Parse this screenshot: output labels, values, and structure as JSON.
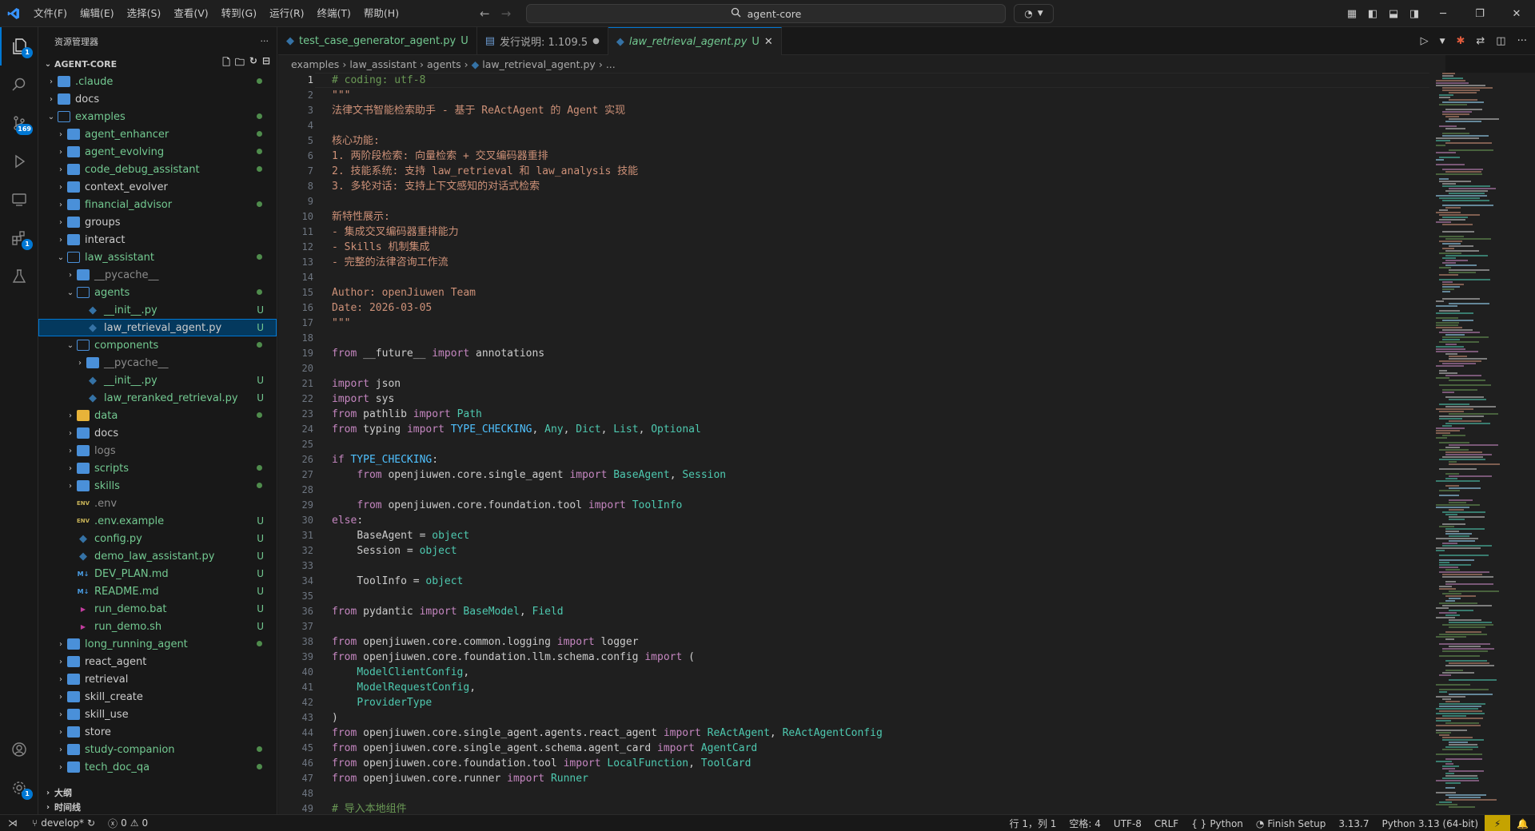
{
  "menu": [
    "文件(F)",
    "编辑(E)",
    "选择(S)",
    "查看(V)",
    "转到(G)",
    "运行(R)",
    "终端(T)",
    "帮助(H)"
  ],
  "command_center": {
    "text": "agent-core"
  },
  "activity": {
    "scm_badge": "169",
    "explorer_badge": "1",
    "ext_badge": "1",
    "account_badge": "1"
  },
  "sidebar": {
    "title": "资源管理器",
    "root": "AGENT-CORE",
    "tree": [
      {
        "label": ".claude",
        "depth": 0,
        "kind": "folder",
        "open": false,
        "color": "green",
        "status": "dot"
      },
      {
        "label": "docs",
        "depth": 0,
        "kind": "folder",
        "open": false,
        "color": "white",
        "status": ""
      },
      {
        "label": "examples",
        "depth": 0,
        "kind": "folder",
        "open": true,
        "color": "green",
        "status": "dot"
      },
      {
        "label": "agent_enhancer",
        "depth": 1,
        "kind": "folder",
        "open": false,
        "color": "green",
        "status": "dot"
      },
      {
        "label": "agent_evolving",
        "depth": 1,
        "kind": "folder",
        "open": false,
        "color": "green",
        "status": "dot"
      },
      {
        "label": "code_debug_assistant",
        "depth": 1,
        "kind": "folder",
        "open": false,
        "color": "green",
        "status": "dot"
      },
      {
        "label": "context_evolver",
        "depth": 1,
        "kind": "folder",
        "open": false,
        "color": "white",
        "status": ""
      },
      {
        "label": "financial_advisor",
        "depth": 1,
        "kind": "folder",
        "open": false,
        "color": "green",
        "status": "dot"
      },
      {
        "label": "groups",
        "depth": 1,
        "kind": "folder",
        "open": false,
        "color": "white",
        "status": ""
      },
      {
        "label": "interact",
        "depth": 1,
        "kind": "folder",
        "open": false,
        "color": "white",
        "status": ""
      },
      {
        "label": "law_assistant",
        "depth": 1,
        "kind": "folder",
        "open": true,
        "color": "green",
        "status": "dot"
      },
      {
        "label": "__pycache__",
        "depth": 2,
        "kind": "folder",
        "open": false,
        "color": "gray",
        "status": ""
      },
      {
        "label": "agents",
        "depth": 2,
        "kind": "folder",
        "open": true,
        "color": "green",
        "status": "dot"
      },
      {
        "label": "__init__.py",
        "depth": 3,
        "kind": "py",
        "color": "green",
        "status": "U"
      },
      {
        "label": "law_retrieval_agent.py",
        "depth": 3,
        "kind": "py",
        "color": "white",
        "status": "U",
        "selected": true
      },
      {
        "label": "components",
        "depth": 2,
        "kind": "folder",
        "open": true,
        "color": "green",
        "status": "dot"
      },
      {
        "label": "__pycache__",
        "depth": 3,
        "kind": "folder",
        "open": false,
        "color": "gray",
        "status": ""
      },
      {
        "label": "__init__.py",
        "depth": 3,
        "kind": "py",
        "color": "green",
        "status": "U"
      },
      {
        "label": "law_reranked_retrieval.py",
        "depth": 3,
        "kind": "py",
        "color": "green",
        "status": "U"
      },
      {
        "label": "data",
        "depth": 2,
        "kind": "folder-yellow",
        "open": false,
        "color": "green",
        "status": "dot"
      },
      {
        "label": "docs",
        "depth": 2,
        "kind": "folder",
        "open": false,
        "color": "white",
        "status": ""
      },
      {
        "label": "logs",
        "depth": 2,
        "kind": "folder",
        "open": false,
        "color": "gray",
        "status": ""
      },
      {
        "label": "scripts",
        "depth": 2,
        "kind": "folder",
        "open": false,
        "color": "green",
        "status": "dot"
      },
      {
        "label": "skills",
        "depth": 2,
        "kind": "folder",
        "open": false,
        "color": "green",
        "status": "dot"
      },
      {
        "label": ".env",
        "depth": 2,
        "kind": "env",
        "color": "gray",
        "status": ""
      },
      {
        "label": ".env.example",
        "depth": 2,
        "kind": "env",
        "color": "green",
        "status": "U"
      },
      {
        "label": "config.py",
        "depth": 2,
        "kind": "py",
        "color": "green",
        "status": "U"
      },
      {
        "label": "demo_law_assistant.py",
        "depth": 2,
        "kind": "py",
        "color": "green",
        "status": "U"
      },
      {
        "label": "DEV_PLAN.md",
        "depth": 2,
        "kind": "md",
        "color": "green",
        "status": "U"
      },
      {
        "label": "README.md",
        "depth": 2,
        "kind": "md",
        "color": "green",
        "status": "U"
      },
      {
        "label": "run_demo.bat",
        "depth": 2,
        "kind": "bat",
        "color": "green",
        "status": "U"
      },
      {
        "label": "run_demo.sh",
        "depth": 2,
        "kind": "bat",
        "color": "green",
        "status": "U"
      },
      {
        "label": "long_running_agent",
        "depth": 1,
        "kind": "folder",
        "open": false,
        "color": "green",
        "status": "dot"
      },
      {
        "label": "react_agent",
        "depth": 1,
        "kind": "folder",
        "open": false,
        "color": "white",
        "status": ""
      },
      {
        "label": "retrieval",
        "depth": 1,
        "kind": "folder",
        "open": false,
        "color": "white",
        "status": ""
      },
      {
        "label": "skill_create",
        "depth": 1,
        "kind": "folder",
        "open": false,
        "color": "white",
        "status": ""
      },
      {
        "label": "skill_use",
        "depth": 1,
        "kind": "folder",
        "open": false,
        "color": "white",
        "status": ""
      },
      {
        "label": "store",
        "depth": 1,
        "kind": "folder",
        "open": false,
        "color": "white",
        "status": ""
      },
      {
        "label": "study-companion",
        "depth": 1,
        "kind": "folder",
        "open": false,
        "color": "green",
        "status": "dot"
      },
      {
        "label": "tech_doc_qa",
        "depth": 1,
        "kind": "folder",
        "open": false,
        "color": "green",
        "status": "dot"
      }
    ],
    "outline": "大纲",
    "timeline": "时间线"
  },
  "tabs": [
    {
      "label": "test_case_generator_agent.py",
      "suffix": "U",
      "icon": "python-icon",
      "active": false
    },
    {
      "label": "发行说明: 1.109.5",
      "suffix": "",
      "icon": "document-icon",
      "active": false
    },
    {
      "label": "law_retrieval_agent.py",
      "suffix": "U",
      "icon": "python-icon",
      "active": true
    }
  ],
  "breadcrumb": [
    "examples",
    "law_assistant",
    "agents",
    "law_retrieval_agent.py",
    "..."
  ],
  "code_lines": [
    [
      [
        "cm",
        "# coding: utf-8"
      ]
    ],
    [
      [
        "doc",
        "\"\"\""
      ]
    ],
    [
      [
        "doc",
        "法律文书智能检索助手 - 基于 ReActAgent 的 Agent 实现"
      ]
    ],
    [
      [
        "doc",
        ""
      ]
    ],
    [
      [
        "doc",
        "核心功能:"
      ]
    ],
    [
      [
        "doc",
        "1. 两阶段检索: 向量检索 + 交叉编码器重排"
      ]
    ],
    [
      [
        "doc",
        "2. 技能系统: 支持 law_retrieval 和 law_analysis 技能"
      ]
    ],
    [
      [
        "doc",
        "3. 多轮对话: 支持上下文感知的对话式检索"
      ]
    ],
    [
      [
        "doc",
        ""
      ]
    ],
    [
      [
        "doc",
        "新特性展示:"
      ]
    ],
    [
      [
        "doc",
        "- 集成交叉编码器重排能力"
      ]
    ],
    [
      [
        "doc",
        "- Skills 机制集成"
      ]
    ],
    [
      [
        "doc",
        "- 完整的法律咨询工作流"
      ]
    ],
    [
      [
        "doc",
        ""
      ]
    ],
    [
      [
        "doc",
        "Author: openJiuwen Team"
      ]
    ],
    [
      [
        "doc",
        "Date: 2026-03-05"
      ]
    ],
    [
      [
        "doc",
        "\"\"\""
      ]
    ],
    [],
    [
      [
        "kw",
        "from"
      ],
      [
        "tx",
        " __future__ "
      ],
      [
        "kw",
        "import"
      ],
      [
        "tx",
        " annotations"
      ]
    ],
    [],
    [
      [
        "kw",
        "import"
      ],
      [
        "tx",
        " json"
      ]
    ],
    [
      [
        "kw",
        "import"
      ],
      [
        "tx",
        " sys"
      ]
    ],
    [
      [
        "kw",
        "from"
      ],
      [
        "tx",
        " pathlib "
      ],
      [
        "kw",
        "import"
      ],
      [
        "tx",
        " "
      ],
      [
        "cls",
        "Path"
      ]
    ],
    [
      [
        "kw",
        "from"
      ],
      [
        "tx",
        " typing "
      ],
      [
        "kw",
        "import"
      ],
      [
        "tx",
        " "
      ],
      [
        "cn",
        "TYPE_CHECKING"
      ],
      [
        "tx",
        ", "
      ],
      [
        "cls",
        "Any"
      ],
      [
        "tx",
        ", "
      ],
      [
        "cls",
        "Dict"
      ],
      [
        "tx",
        ", "
      ],
      [
        "cls",
        "List"
      ],
      [
        "tx",
        ", "
      ],
      [
        "cls",
        "Optional"
      ]
    ],
    [],
    [
      [
        "kw",
        "if"
      ],
      [
        "tx",
        " "
      ],
      [
        "cn",
        "TYPE_CHECKING"
      ],
      [
        "tx",
        ":"
      ]
    ],
    [
      [
        "tx",
        "    "
      ],
      [
        "kw",
        "from"
      ],
      [
        "tx",
        " openjiuwen.core.single_agent "
      ],
      [
        "kw",
        "import"
      ],
      [
        "tx",
        " "
      ],
      [
        "cls",
        "BaseAgent"
      ],
      [
        "tx",
        ", "
      ],
      [
        "cls",
        "Session"
      ]
    ],
    [],
    [
      [
        "tx",
        "    "
      ],
      [
        "kw",
        "from"
      ],
      [
        "tx",
        " openjiuwen.core.foundation.tool "
      ],
      [
        "kw",
        "import"
      ],
      [
        "tx",
        " "
      ],
      [
        "cls",
        "ToolInfo"
      ]
    ],
    [
      [
        "kw",
        "else"
      ],
      [
        "tx",
        ":"
      ]
    ],
    [
      [
        "tx",
        "    "
      ],
      [
        "tx",
        "BaseAgent"
      ],
      [
        "tx",
        " = "
      ],
      [
        "bi",
        "object"
      ]
    ],
    [
      [
        "tx",
        "    "
      ],
      [
        "tx",
        "Session"
      ],
      [
        "tx",
        " = "
      ],
      [
        "bi",
        "object"
      ]
    ],
    [],
    [
      [
        "tx",
        "    "
      ],
      [
        "tx",
        "ToolInfo"
      ],
      [
        "tx",
        " = "
      ],
      [
        "bi",
        "object"
      ]
    ],
    [],
    [
      [
        "kw",
        "from"
      ],
      [
        "tx",
        " pydantic "
      ],
      [
        "kw",
        "import"
      ],
      [
        "tx",
        " "
      ],
      [
        "cls",
        "BaseModel"
      ],
      [
        "tx",
        ", "
      ],
      [
        "cls",
        "Field"
      ]
    ],
    [],
    [
      [
        "kw",
        "from"
      ],
      [
        "tx",
        " openjiuwen.core.common.logging "
      ],
      [
        "kw",
        "import"
      ],
      [
        "tx",
        " logger"
      ]
    ],
    [
      [
        "kw",
        "from"
      ],
      [
        "tx",
        " openjiuwen.core.foundation.llm.schema.config "
      ],
      [
        "kw",
        "import"
      ],
      [
        "tx",
        " ("
      ]
    ],
    [
      [
        "tx",
        "    "
      ],
      [
        "cls",
        "ModelClientConfig"
      ],
      [
        "tx",
        ","
      ]
    ],
    [
      [
        "tx",
        "    "
      ],
      [
        "cls",
        "ModelRequestConfig"
      ],
      [
        "tx",
        ","
      ]
    ],
    [
      [
        "tx",
        "    "
      ],
      [
        "cls",
        "ProviderType"
      ]
    ],
    [
      [
        "tx",
        ")"
      ]
    ],
    [
      [
        "kw",
        "from"
      ],
      [
        "tx",
        " openjiuwen.core.single_agent.agents.react_agent "
      ],
      [
        "kw",
        "import"
      ],
      [
        "tx",
        " "
      ],
      [
        "cls",
        "ReActAgent"
      ],
      [
        "tx",
        ", "
      ],
      [
        "cls",
        "ReActAgentConfig"
      ]
    ],
    [
      [
        "kw",
        "from"
      ],
      [
        "tx",
        " openjiuwen.core.single_agent.schema.agent_card "
      ],
      [
        "kw",
        "import"
      ],
      [
        "tx",
        " "
      ],
      [
        "cls",
        "AgentCard"
      ]
    ],
    [
      [
        "kw",
        "from"
      ],
      [
        "tx",
        " openjiuwen.core.foundation.tool "
      ],
      [
        "kw",
        "import"
      ],
      [
        "tx",
        " "
      ],
      [
        "cls",
        "LocalFunction"
      ],
      [
        "tx",
        ", "
      ],
      [
        "cls",
        "ToolCard"
      ]
    ],
    [
      [
        "kw",
        "from"
      ],
      [
        "tx",
        " openjiuwen.core.runner "
      ],
      [
        "kw",
        "import"
      ],
      [
        "tx",
        " "
      ],
      [
        "cls",
        "Runner"
      ]
    ],
    [],
    [
      [
        "cm",
        "# 导入本地组件"
      ]
    ]
  ],
  "status": {
    "branch": "develop*",
    "errors": "0",
    "warnings": "0",
    "cursor": "行 1，列 1",
    "indent": "空格: 4",
    "encoding": "UTF-8",
    "eol": "CRLF",
    "language": "Python",
    "finish_setup": "Finish Setup",
    "py_version": "3.13.7",
    "interpreter": "Python 3.13 (64-bit)"
  }
}
